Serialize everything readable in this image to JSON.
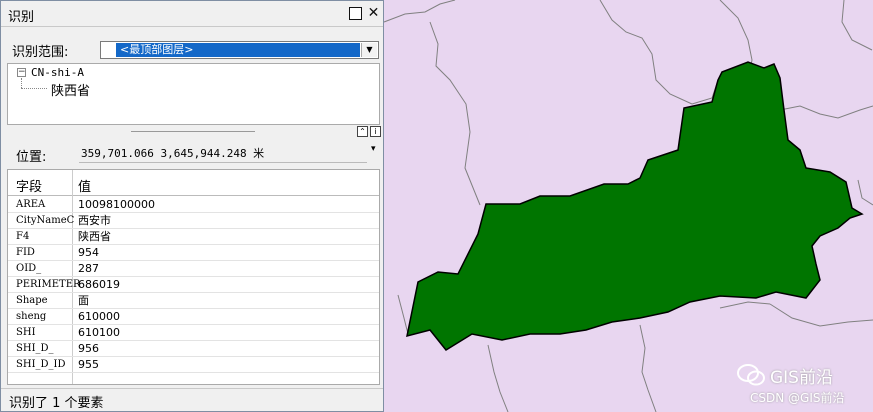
{
  "colors": {
    "map_background": "#e8d6f0",
    "province_fill": "#007500",
    "boundary_line": "#808080",
    "selection_highlight": "#1468c8"
  },
  "window": {
    "title": "识别",
    "pin_icon": "pin-icon",
    "close_icon": "close-icon"
  },
  "scope": {
    "label": "识别范围:",
    "selected": "<最顶部图层>"
  },
  "tree": {
    "layer": "CN-shi-A",
    "feature": "陕西省"
  },
  "location": {
    "label": "位置:",
    "value": "359,701.066  3,645,944.248 米"
  },
  "table": {
    "headers": {
      "field": "字段",
      "value": "值"
    },
    "rows": [
      {
        "field": "AREA",
        "value": "10098100000"
      },
      {
        "field": "CityNameC",
        "value": "西安市"
      },
      {
        "field": "F4",
        "value": "陕西省"
      },
      {
        "field": "FID",
        "value": "954"
      },
      {
        "field": "OID_",
        "value": "287"
      },
      {
        "field": "PERIMETER",
        "value": "686019"
      },
      {
        "field": "Shape",
        "value": "面"
      },
      {
        "field": "sheng",
        "value": "610000"
      },
      {
        "field": "SHI",
        "value": "610100"
      },
      {
        "field": "SHI_D_",
        "value": "956"
      },
      {
        "field": "SHI_D_ID",
        "value": "955"
      }
    ]
  },
  "status": "识别了 1 个要素",
  "watermark": {
    "title": "GIS前沿",
    "sub": "CSDN @GIS前沿"
  }
}
